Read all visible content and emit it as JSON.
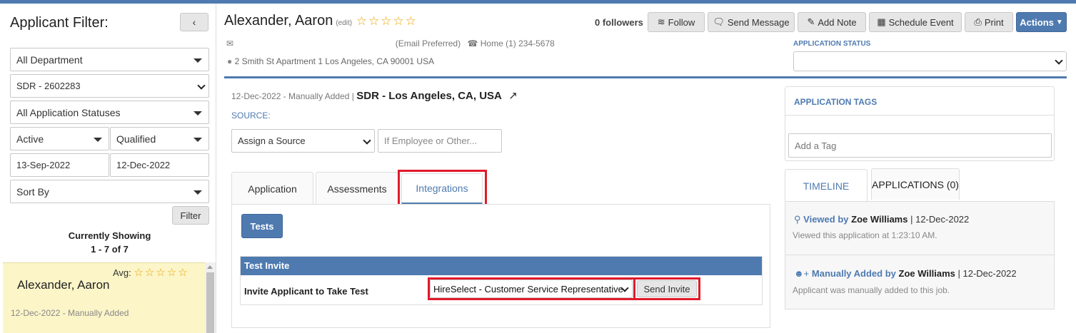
{
  "sidebar": {
    "title": "Applicant Filter:",
    "department": "All Department",
    "job": "SDR - 2602283",
    "statuses": "All Application Statuses",
    "active": "Active",
    "qualified": "Qualified",
    "date_from": "13-Sep-2022",
    "date_to": "12-Dec-2022",
    "sort_by": "Sort By",
    "filter_btn": "Filter",
    "currently_showing": "Currently Showing",
    "count": "1 - 7 of 7",
    "avg_label": "Avg:",
    "applicant_name": "Alexander, Aaron",
    "applicant_date": "12-Dec-2022 - Manually Added"
  },
  "header": {
    "name": "Alexander, Aaron",
    "edit": "(edit)",
    "followers": "0 followers",
    "follow": "Follow",
    "send_message": "Send Message",
    "add_note": "Add Note",
    "schedule_event": "Schedule Event",
    "print": "Print",
    "actions": "Actions",
    "email_pref": "(Email Preferred)",
    "phone": "Home (1) 234-5678",
    "address": "2 Smith St Apartment 1 Los Angeles, CA 90001 USA",
    "app_status_label": "APPLICATION STATUS"
  },
  "main": {
    "added_info": "12-Dec-2022 - Manually Added |",
    "job_title": "SDR - Los Angeles, CA, USA",
    "source_label": "SOURCE:",
    "source_select": "Assign a Source",
    "employee_placeholder": "If Employee or Other...",
    "tabs": [
      "Application",
      "Assessments",
      "Integrations"
    ],
    "tests_btn": "Tests",
    "test_invite_header": "Test Invite",
    "invite_label": "Invite Applicant to Take Test",
    "test_select": "HireSelect - Customer Service Representative",
    "send_invite": "Send Invite"
  },
  "right": {
    "tags_title": "APPLICATION TAGS",
    "tag_placeholder": "Add a Tag",
    "tab_timeline": "TIMELINE",
    "tab_applications": "APPLICATIONS (0)",
    "ev1_action": "Viewed by",
    "ev1_user": "Zoe Williams",
    "ev1_date": "| 12-Dec-2022",
    "ev1_desc": "Viewed this application at 1:23:10 AM.",
    "ev2_action": "Manually Added by",
    "ev2_user": "Zoe Williams",
    "ev2_date": "| 12-Dec-2022",
    "ev2_desc": "Applicant was manually added to this job."
  },
  "colors": {
    "accent": "#4e7ab0",
    "highlight": "#e11a2b",
    "star": "#e8a300",
    "selected_row": "#fcf5c8"
  }
}
